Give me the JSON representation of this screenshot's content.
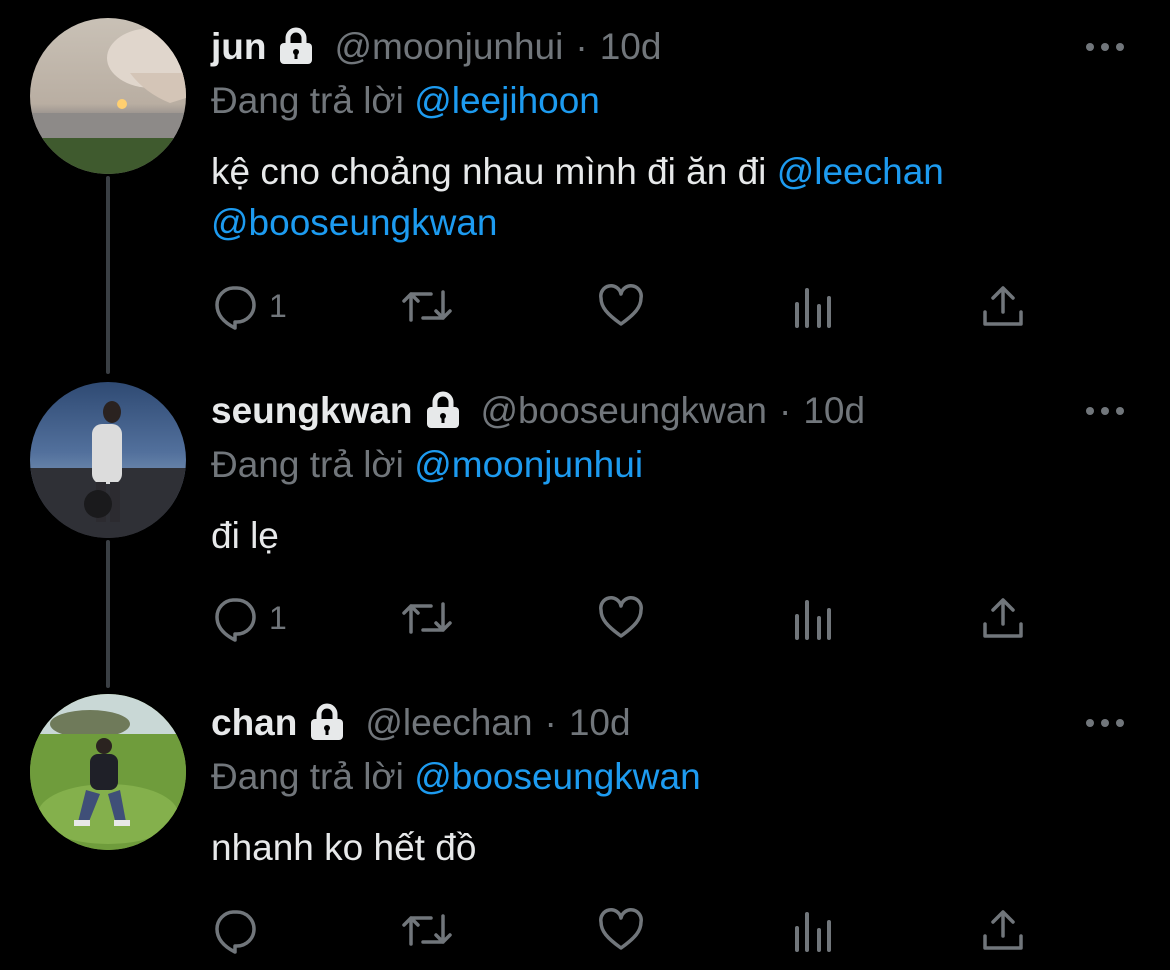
{
  "colors": {
    "background": "#000000",
    "text": "#e7e9ea",
    "secondary": "#71767b",
    "mention": "#1d9bf0",
    "thread_line": "#3a3f44"
  },
  "tweets": [
    {
      "display_name": "jun",
      "handle": "@moonjunhui",
      "separator": "·",
      "time": "10d",
      "reply_prefix": "Đang trả lời",
      "reply_to": "@leejihoon",
      "text_line1": "kệ cno choảng nhau mình đi ăn đi ",
      "mention1": "@leechan",
      "mention2": "@booseungkwan",
      "reply_count": "1",
      "icons": [
        "lock-icon",
        "more-icon",
        "reply-icon",
        "retweet-icon",
        "like-icon",
        "analytics-icon",
        "share-icon"
      ]
    },
    {
      "display_name": "seungkwan",
      "handle": "@booseungkwan",
      "separator": "·",
      "time": "10d",
      "reply_prefix": "Đang trả lời",
      "reply_to": "@moonjunhui",
      "text": "đi lẹ",
      "reply_count": "1"
    },
    {
      "display_name": "chan",
      "handle": "@leechan",
      "separator": "·",
      "time": "10d",
      "reply_prefix": "Đang trả lời",
      "reply_to": "@booseungkwan",
      "text": "nhanh ko hết đồ",
      "reply_count": ""
    }
  ]
}
